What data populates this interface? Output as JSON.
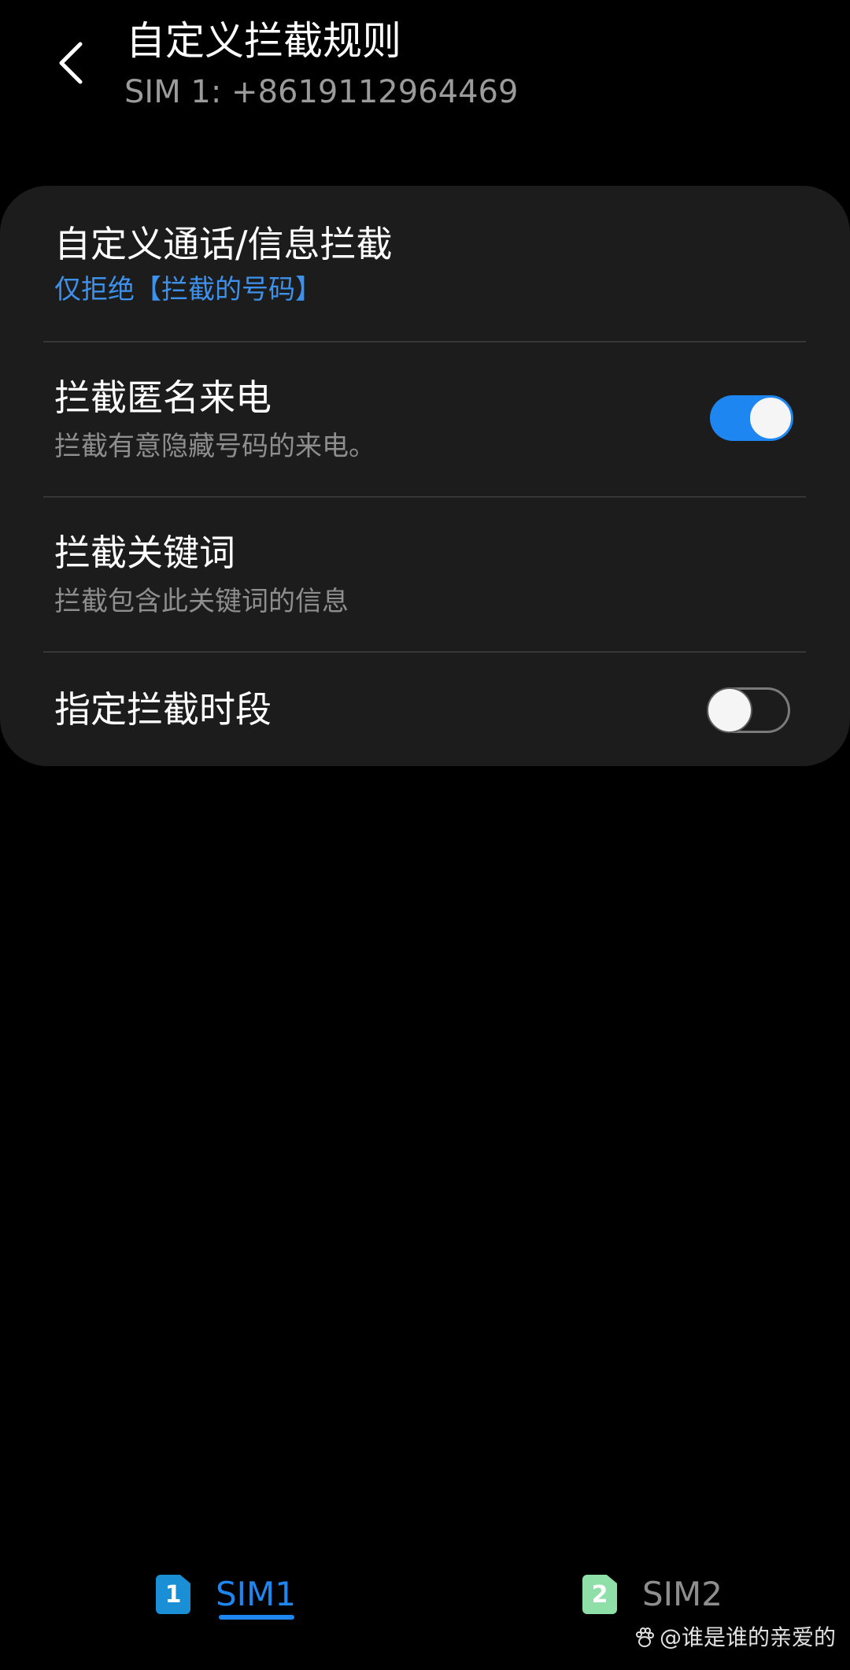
{
  "header": {
    "title": "自定义拦截规则",
    "subtitle": "SIM 1: +8619112964469"
  },
  "settings": [
    {
      "title": "自定义通话/信息拦截",
      "subtitle": "仅拒绝【拦截的号码】"
    },
    {
      "title": "拦截匿名来电",
      "subtitle": "拦截有意隐藏号码的来电。",
      "toggle": "on"
    },
    {
      "title": "拦截关键词",
      "subtitle": "拦截包含此关键词的信息"
    },
    {
      "title": "指定拦截时段",
      "toggle": "off"
    }
  ],
  "tabs": [
    {
      "badge": "1",
      "label": "SIM1",
      "active": true
    },
    {
      "badge": "2",
      "label": "SIM2",
      "active": false
    }
  ],
  "watermark": "@谁是谁的亲爱的",
  "colors": {
    "accent": "#1e86f0",
    "card": "#1c1c1c",
    "background": "#000000",
    "sim1": "#1a8fd6",
    "sim2": "#8fe0a8"
  }
}
